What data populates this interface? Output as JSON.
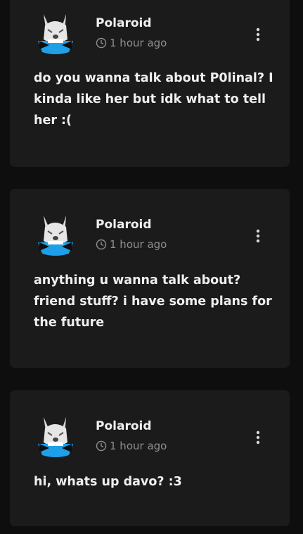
{
  "posts": [
    {
      "author": "Polaroid",
      "time": "1 hour ago",
      "text": "do you wanna talk about P0linal? I kinda like her but idk what to tell her :(",
      "avatar_icon": "dog-avatar-icon",
      "menu_icon": "more-vertical-icon"
    },
    {
      "author": "Polaroid",
      "time": "1 hour ago",
      "text": "anything u wanna talk about? friend stuff? i have some plans for the future",
      "avatar_icon": "dog-avatar-icon",
      "menu_icon": "more-vertical-icon"
    },
    {
      "author": "Polaroid",
      "time": "1 hour ago",
      "text": "hi, whats up davo? :3",
      "avatar_icon": "dog-avatar-icon",
      "menu_icon": "more-vertical-icon"
    }
  ],
  "colors": {
    "background": "#0e0e0e",
    "card": "#1b1b1c",
    "text_primary": "#efefef",
    "text_muted": "#8e8e8e",
    "avatar_accent": "#1f9fe8"
  }
}
